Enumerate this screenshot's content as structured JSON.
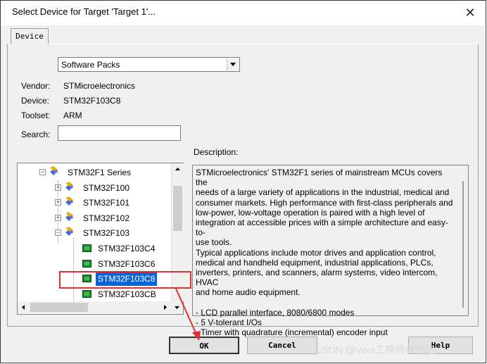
{
  "window": {
    "title": "Select Device for Target 'Target 1'..."
  },
  "tabs": [
    {
      "label": "Device"
    }
  ],
  "pack_selector": {
    "value": "Software Packs"
  },
  "info": {
    "vendor_label": "Vendor:",
    "vendor_value": "STMicroelectronics",
    "device_label": "Device:",
    "device_value": "STM32F103C8",
    "toolset_label": "Toolset:",
    "toolset_value": "ARM",
    "search_label": "Search:",
    "search_value": ""
  },
  "description": {
    "label": "Description:",
    "lines": [
      "STMicroelectronics' STM32F1 series of mainstream MCUs covers the",
      "needs of a large variety of applications in the industrial, medical and",
      "consumer markets. High performance with first-class peripherals and",
      "low-power, low-voltage operation is paired with a high level of",
      "integration at accessible prices with a simple architecture and easy-to-",
      "use tools.",
      "Typical applications include motor drives and application control,",
      "medical and handheld equipment, industrial applications, PLCs,",
      "inverters, printers, and scanners, alarm systems, video intercom, HVAC",
      "and home audio equipment.",
      "",
      " - LCD parallel interface, 8080/6800 modes",
      " - 5 V-tolerant I/Os",
      " - Timer with quadrature (incremental) encoder input"
    ]
  },
  "tree": {
    "series": "STM32F1 Series",
    "families": [
      "STM32F100",
      "STM32F101",
      "STM32F102",
      "STM32F103"
    ],
    "devices": [
      "STM32F103C4",
      "STM32F103C6",
      "STM32F103C8",
      "STM32F103CB"
    ],
    "selected": "STM32F103C8"
  },
  "buttons": {
    "ok": "OK",
    "cancel": "Cancel",
    "help": "Help"
  },
  "watermark": "CSDN @Vera工程师养成记",
  "colors": {
    "selection": "#0a64d6",
    "annotation": "#e03030",
    "chip": "#1e8a2e"
  }
}
